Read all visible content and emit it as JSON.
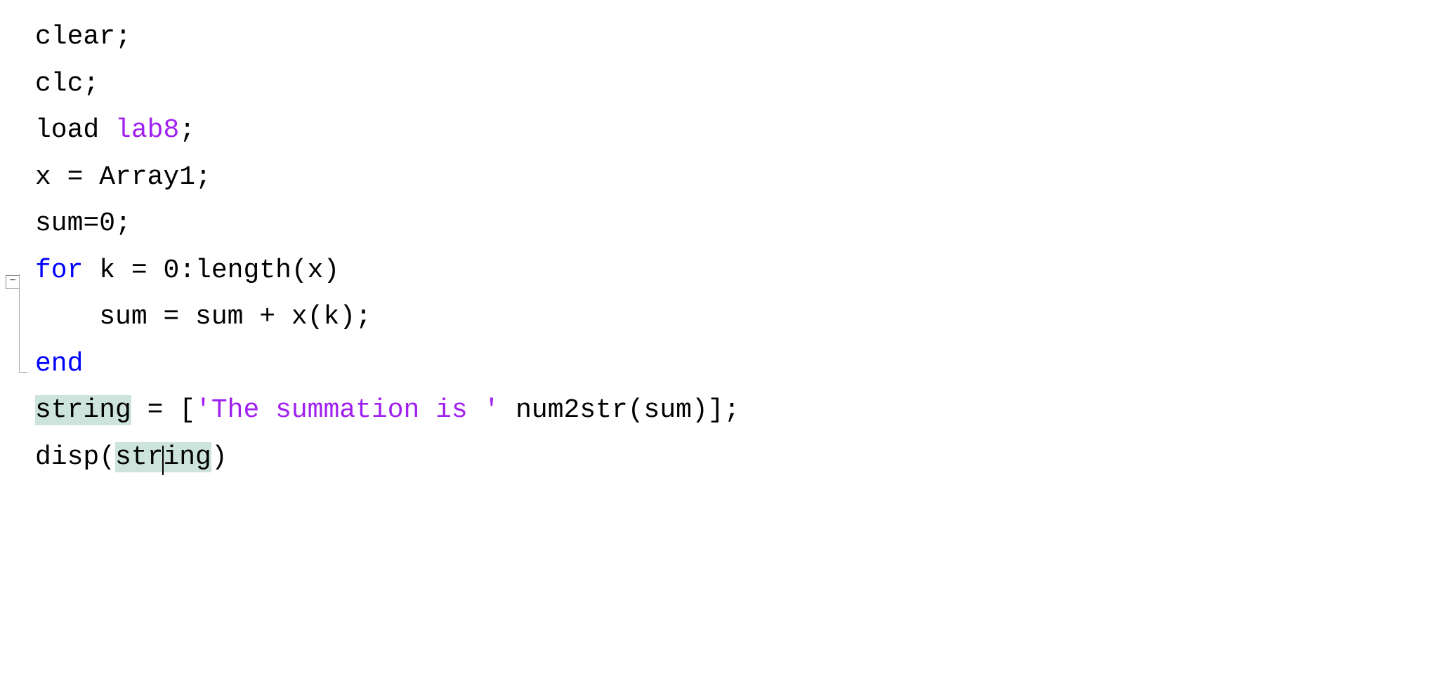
{
  "code": {
    "line1": "clear;",
    "line2": "clc;",
    "line3_a": "load ",
    "line3_b": "lab8",
    "line3_c": ";",
    "line4": "x = Array1;",
    "line5": "sum=0;",
    "line6_a": "for",
    "line6_b": " k = 0:length(x)",
    "line7": "    sum = sum + x(k);",
    "line8": "end",
    "line9_a": "string",
    "line9_b": " = [",
    "line9_c": "'The summation is '",
    "line9_d": " num2str(sum)];",
    "line10_a": "disp(",
    "line10_b": "str",
    "line10_c": "ing",
    "line10_d": ")"
  },
  "fold": {
    "symbol": "−"
  }
}
